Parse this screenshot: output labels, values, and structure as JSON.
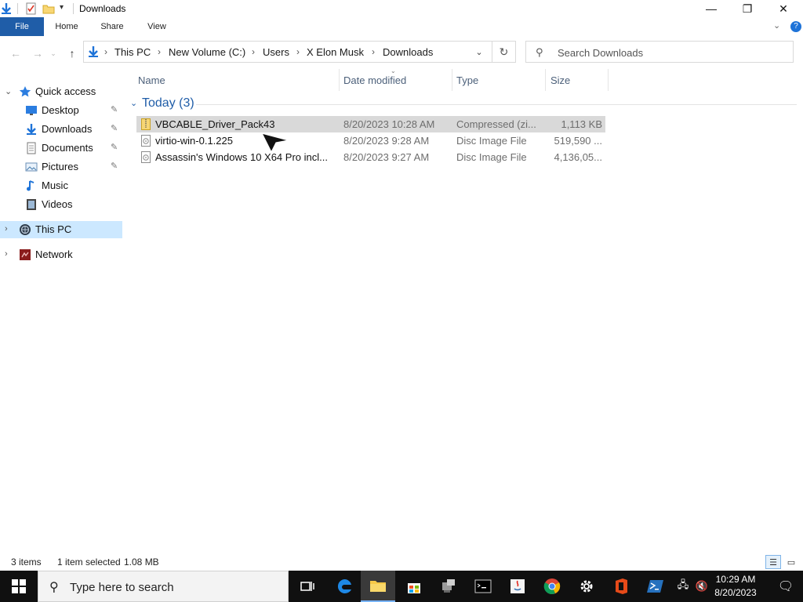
{
  "window": {
    "title": "Downloads",
    "minimize_glyph": "—",
    "maximize_glyph": "❐",
    "close_glyph": "✕"
  },
  "ribbon": {
    "tabs": [
      "File",
      "Home",
      "Share",
      "View"
    ],
    "collapse_glyph": "⌄",
    "help_glyph": "?"
  },
  "address": {
    "crumbs": [
      "This PC",
      "New Volume (C:)",
      "Users",
      "X Elon Musk",
      "Downloads"
    ],
    "chevron": "›",
    "dropdown_glyph": "⌄",
    "refresh_glyph": "↻"
  },
  "search": {
    "placeholder": "Search Downloads"
  },
  "nav": {
    "quick_access": "Quick access",
    "items": [
      {
        "label": "Desktop",
        "pinned": true,
        "icon": "desktop-icon"
      },
      {
        "label": "Downloads",
        "pinned": true,
        "icon": "downloads-icon"
      },
      {
        "label": "Documents",
        "pinned": true,
        "icon": "documents-icon"
      },
      {
        "label": "Pictures",
        "pinned": true,
        "icon": "pictures-icon"
      },
      {
        "label": "Music",
        "pinned": false,
        "icon": "music-icon"
      },
      {
        "label": "Videos",
        "pinned": false,
        "icon": "videos-icon"
      }
    ],
    "this_pc": "This PC",
    "network": "Network",
    "pin_glyph": "📌"
  },
  "columns": {
    "name": "Name",
    "date": "Date modified",
    "type": "Type",
    "size": "Size"
  },
  "group": {
    "label": "Today (3)"
  },
  "files": [
    {
      "name": "VBCABLE_Driver_Pack43",
      "date": "8/20/2023 10:28 AM",
      "type": "Compressed (zi...",
      "size": "1,113 KB",
      "icon": "zip-folder-icon",
      "selected": true
    },
    {
      "name": "virtio-win-0.1.225",
      "date": "8/20/2023 9:28 AM",
      "type": "Disc Image File",
      "size": "519,590 ...",
      "icon": "disc-image-icon",
      "selected": false
    },
    {
      "name": "Assassin's Windows 10 X64 Pro incl...",
      "date": "8/20/2023 9:27 AM",
      "type": "Disc Image File",
      "size": "4,136,05...",
      "icon": "disc-image-icon",
      "selected": false
    }
  ],
  "status": {
    "item_count": "3 items",
    "selection": "1 item selected",
    "selection_size": "1.08 MB"
  },
  "taskbar": {
    "search_placeholder": "Type here to search",
    "time": "10:29 AM",
    "date": "8/20/2023"
  },
  "colors": {
    "file_tab": "#1f5da8",
    "selection": "#cce8ff",
    "row_selected": "#d9d9d9",
    "group_header": "#1f5da8",
    "taskbar": "#101010"
  }
}
